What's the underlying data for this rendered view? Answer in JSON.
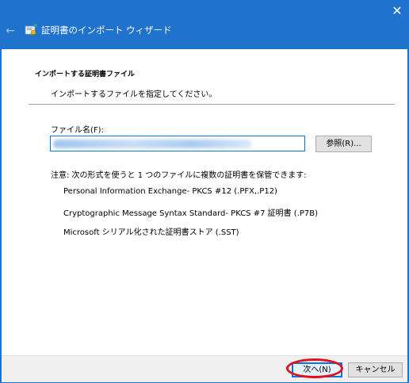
{
  "window": {
    "title": "証明書のインポート ウィザード",
    "close_glyph": "✕",
    "back_glyph": "←"
  },
  "page": {
    "section_title": "インポートする証明書ファイル",
    "section_subtitle": "インポートするファイルを指定してください。"
  },
  "file": {
    "label": "ファイル名(F):",
    "value_redacted": "●●●●●●●●●●●●●●●●●●●●●●●●●●●●●●●●●●●"
  },
  "buttons": {
    "browse": "参照(R)...",
    "next": "次へ(N)",
    "cancel": "キャンセル"
  },
  "note": {
    "heading": "注意: 次の形式を使うと 1 つのファイルに複数の証明書を保管できます:",
    "formats": [
      "Personal Information Exchange- PKCS #12 (.PFX,.P12)",
      "Cryptographic Message Syntax Standard- PKCS #7 証明書 (.P7B)",
      "Microsoft シリアル化された証明書ストア (.SST)"
    ]
  },
  "colors": {
    "titlebar": "#1f73cc",
    "focus_border": "#0078d7",
    "highlight_ring": "#e3101a"
  }
}
